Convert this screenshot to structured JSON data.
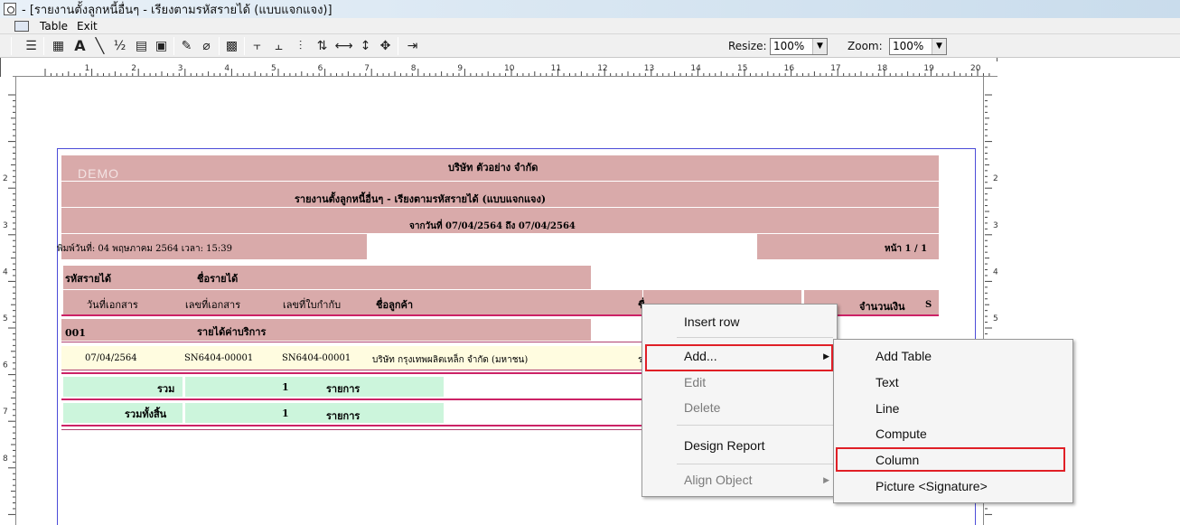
{
  "window": {
    "title": "- [รายงานตั้งลูกหนี้อื่นๆ - เรียงตามรหัสรายได้ (แบบแจกแจง)]"
  },
  "menu": {
    "items": [
      "Table",
      "Exit"
    ]
  },
  "toolbar": {
    "resize_label": "Resize:",
    "resize_value": "100%",
    "zoom_label": "Zoom:",
    "zoom_value": "100%"
  },
  "ruler": {
    "h_numbers": [
      "1",
      "2",
      "3",
      "4",
      "5",
      "6",
      "7",
      "8",
      "9",
      "10",
      "11",
      "12",
      "13",
      "14",
      "15",
      "16",
      "17",
      "18",
      "19",
      "20"
    ],
    "v_numbers": [
      "2",
      "3",
      "4",
      "5",
      "6",
      "7",
      "8"
    ]
  },
  "report": {
    "demo": "DEMO",
    "company": "บริษัท ตัวอย่าง จำกัด",
    "report_title": "รายงานตั้งลูกหนี้อื่นๆ - เรียงตามรหัสรายได้ (แบบแจกแจง)",
    "date_range": "จากวันที่ 07/04/2564 ถึง 07/04/2564",
    "print_info": "พิมพ์วันที่: 04 พฤษภาคม 2564 เวลา: 15:39",
    "page_info": "หน้า 1 / 1",
    "headers": {
      "revenue_code": "รหัสรายได้",
      "revenue_name": "ชื่อรายได้",
      "doc_date": "วันที่เอกสาร",
      "doc_no": "เลขที่เอกสาร",
      "ref_no": "เลขที่ใบกำกับ",
      "customer": "ชื่อลูกค้า",
      "partial": "ชื่",
      "amount": "จำนวนเงิน",
      "s": "S"
    },
    "group": {
      "code": "001",
      "name": "รายได้ค่าบริการ"
    },
    "detail": {
      "date": "07/04/2564",
      "doc_no": "SN6404-00001",
      "ref_no": "SN6404-00001",
      "customer": "บริษัท กรุงเทพผลิตเหล็ก จำกัด (มหาชน)",
      "partial": "ร"
    },
    "subtotal": {
      "label": "รวม",
      "count": "1",
      "unit": "รายการ"
    },
    "grandtotal": {
      "label": "รวมทั้งสิ้น",
      "count": "1",
      "unit": "รายการ"
    }
  },
  "context_menu": {
    "items": [
      {
        "label": "Insert row",
        "enabled": true
      },
      {
        "label": "Add...",
        "enabled": true,
        "submenu": true
      },
      {
        "label": "Edit",
        "enabled": false
      },
      {
        "label": "Delete",
        "enabled": false
      },
      {
        "label": "Design Report",
        "enabled": true
      },
      {
        "label": "Align Object",
        "enabled": false,
        "submenu": true
      }
    ]
  },
  "submenu": {
    "items": [
      "Add Table",
      "Text",
      "Line",
      "Compute",
      "Column",
      "Picture <Signature>"
    ]
  },
  "colors": {
    "band": "#d9aaaa",
    "highlight": "#e01f26",
    "margin": "#4b4bd8"
  }
}
